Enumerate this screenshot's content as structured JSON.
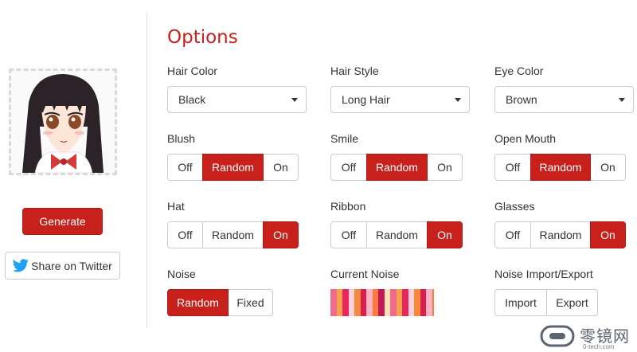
{
  "left": {
    "generate_label": "Generate",
    "twitter_label": "Share on Twitter"
  },
  "options": {
    "title": "Options",
    "hair_color": {
      "label": "Hair Color",
      "value": "Black"
    },
    "hair_style": {
      "label": "Hair Style",
      "value": "Long Hair"
    },
    "eye_color": {
      "label": "Eye Color",
      "value": "Brown"
    },
    "blush": {
      "label": "Blush",
      "choices": [
        "Off",
        "Random",
        "On"
      ],
      "selected": "Random"
    },
    "smile": {
      "label": "Smile",
      "choices": [
        "Off",
        "Random",
        "On"
      ],
      "selected": "Random"
    },
    "open_mouth": {
      "label": "Open Mouth",
      "choices": [
        "Off",
        "Random",
        "On"
      ],
      "selected": "Random"
    },
    "hat": {
      "label": "Hat",
      "choices": [
        "Off",
        "Random",
        "On"
      ],
      "selected": "On"
    },
    "ribbon": {
      "label": "Ribbon",
      "choices": [
        "Off",
        "Random",
        "On"
      ],
      "selected": "On"
    },
    "glasses": {
      "label": "Glasses",
      "choices": [
        "Off",
        "Random",
        "On"
      ],
      "selected": "On"
    },
    "noise": {
      "label": "Noise",
      "choices": [
        "Random",
        "Fixed"
      ],
      "selected": "Random"
    },
    "current_noise": {
      "label": "Current Noise"
    },
    "noise_io": {
      "label": "Noise Import/Export",
      "import_label": "Import",
      "export_label": "Export"
    }
  },
  "colors": {
    "accent": "#c8211c",
    "noise_palette": [
      "#f06a8e",
      "#f7a24a",
      "#e8265d",
      "#ffd0dc",
      "#f58a3c",
      "#d81f4f",
      "#fbb3c4",
      "#ff7a3d",
      "#c2185b",
      "#ffe0b2"
    ]
  },
  "watermark": {
    "text": "零镜网",
    "sub": "0-tech.com"
  }
}
